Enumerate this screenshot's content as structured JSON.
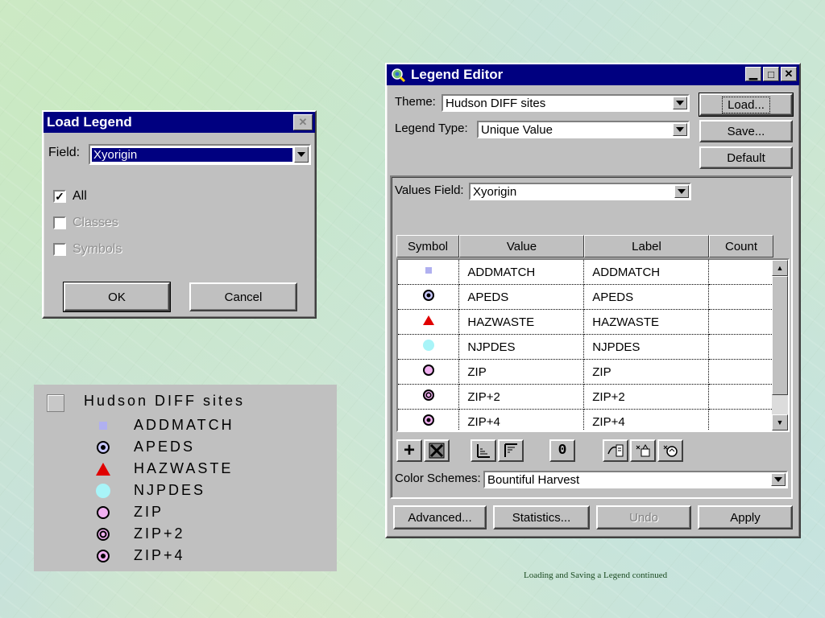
{
  "load_legend": {
    "title": "Load Legend",
    "close_label": "✕",
    "field_label": "Field:",
    "field_value": "Xyorigin",
    "all_label": "All",
    "classes_label": "Classes",
    "symbols_label": "Symbols",
    "ok_label": "OK",
    "cancel_label": "Cancel"
  },
  "legend_editor": {
    "title": "Legend Editor",
    "theme_label": "Theme:",
    "theme_value": "Hudson DIFF sites",
    "legend_type_label": "Legend Type:",
    "legend_type_value": "Unique Value",
    "load_label": "Load...",
    "save_label": "Save...",
    "default_label": "Default",
    "values_field_label": "Values Field:",
    "values_field_value": "Xyorigin",
    "columns": [
      "Symbol",
      "Value",
      "Label",
      "Count"
    ],
    "rows": [
      {
        "symbol": "square-lavender-icon",
        "value": "ADDMATCH",
        "label": "ADDMATCH",
        "count": ""
      },
      {
        "symbol": "circle-dot-blue-icon",
        "value": "APEDS",
        "label": "APEDS",
        "count": ""
      },
      {
        "symbol": "triangle-red-icon",
        "value": "HAZWASTE",
        "label": "HAZWASTE",
        "count": ""
      },
      {
        "symbol": "circle-cyan-icon",
        "value": "NJPDES",
        "label": "NJPDES",
        "count": ""
      },
      {
        "symbol": "circle-pink-icon",
        "value": "ZIP",
        "label": "ZIP",
        "count": ""
      },
      {
        "symbol": "circle-double-icon",
        "value": "ZIP+2",
        "label": "ZIP+2",
        "count": ""
      },
      {
        "symbol": "circle-dot-pink-icon",
        "value": "ZIP+4",
        "label": "ZIP+4",
        "count": ""
      }
    ],
    "color_schemes_label": "Color Schemes:",
    "color_schemes_value": "Bountiful Harvest",
    "advanced_label": "Advanced...",
    "statistics_label": "Statistics...",
    "undo_label": "Undo",
    "apply_label": "Apply",
    "tool_zero_label": "0"
  },
  "legend_panel": {
    "title": "Hudson DIFF sites",
    "items": [
      "ADDMATCH",
      "APEDS",
      "HAZWASTE",
      "NJPDES",
      "ZIP",
      "ZIP+2",
      "ZIP+4"
    ]
  },
  "footer": {
    "caption": "Loading and Saving a Legend continued"
  },
  "colors": {
    "titlebar": "#000080",
    "window": "#c0c0c0",
    "lavender": "#b0b0f0",
    "red": "#e00000",
    "cyan": "#a8f4f8",
    "pink": "#f0b0f0"
  }
}
